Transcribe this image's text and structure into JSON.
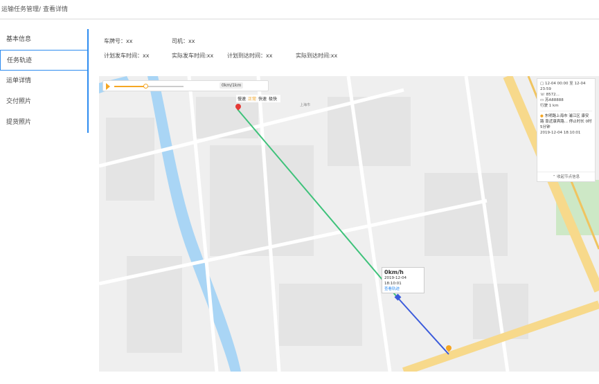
{
  "breadcrumb": {
    "parent": "运输任务管理",
    "sep": "/",
    "current": "查看详情"
  },
  "sidebar": {
    "items": [
      {
        "label": "基本信息"
      },
      {
        "label": "任务轨迹"
      },
      {
        "label": "运单详情"
      },
      {
        "label": "交付照片"
      },
      {
        "label": "提货照片"
      }
    ],
    "active_index": 1
  },
  "info": {
    "plate_label": "车牌号：",
    "plate_value": "xx",
    "driver_label": "司机：",
    "driver_value": "xx",
    "plan_depart_label": "计划发车时间：",
    "plan_depart_value": "xx",
    "actual_depart_label": "实际发车时间:",
    "actual_depart_value": "xx",
    "plan_arrive_label": "计划到达时间：",
    "plan_arrive_value": "xx",
    "actual_arrive_label": "实际到达时间:",
    "actual_arrive_value": "xx"
  },
  "player": {
    "progress": 0.45,
    "speed_label": "0km/1km",
    "speed_options": [
      "慢速",
      "正常",
      "快速",
      "极快"
    ],
    "speed_selected": "正常"
  },
  "track_panel": {
    "time_range": "12-04 00:00 至 12-04 23:59",
    "phone": "8572...",
    "plate": "苏A88888",
    "mileage_label": "行驶",
    "mileage_value": "1",
    "mileage_unit": "km",
    "address": "东明路上海市 浦江区 康安路 靠近康宾路... 停止时长 0时5分钟",
    "address_time": "2019-12-04 18:10:01",
    "collapse_label": "收起节点信息"
  },
  "popup": {
    "speed": "0km/h",
    "time": "2019-12-04 18:10:01",
    "link": "查看轨迹"
  },
  "colors": {
    "accent": "#2d8cf0",
    "route_green": "#3ec27a",
    "route_blue": "#3b5bdb",
    "orange": "#f5a623"
  }
}
